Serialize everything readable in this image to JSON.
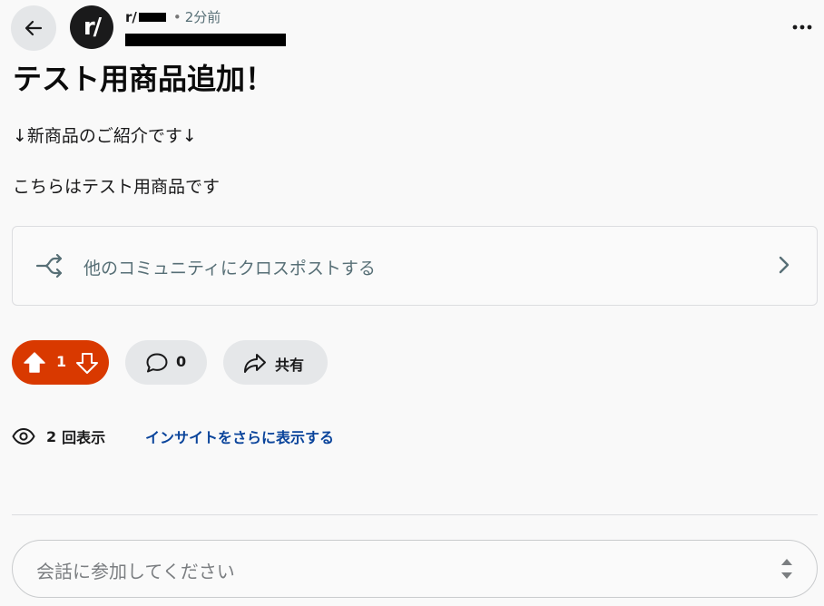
{
  "header": {
    "subreddit_prefix": "r/",
    "separator": "•",
    "time": "2分前",
    "avatar_text": "r/"
  },
  "post": {
    "title": "テスト用商品追加！",
    "body": [
      "↓新商品のご紹介です↓",
      "こちらはテスト用商品です"
    ]
  },
  "crosspost": {
    "label": "他のコミュニティにクロスポストする"
  },
  "actions": {
    "vote_count": "1",
    "comment_count": "0",
    "share_label": "共有"
  },
  "views": {
    "count": "2",
    "label": "回表示",
    "insights_link": "インサイトをさらに表示する"
  },
  "comment_input": {
    "placeholder": "会話に参加してください"
  },
  "colors": {
    "vote_active": "#d93900",
    "link": "#0a449b",
    "pill_bg": "#e5e7e9"
  },
  "icons": [
    "back-arrow-icon",
    "more-icon",
    "crosspost-icon",
    "chevron-right-icon",
    "upvote-icon",
    "downvote-icon",
    "comment-icon",
    "share-icon",
    "eye-icon",
    "expand-icon"
  ]
}
